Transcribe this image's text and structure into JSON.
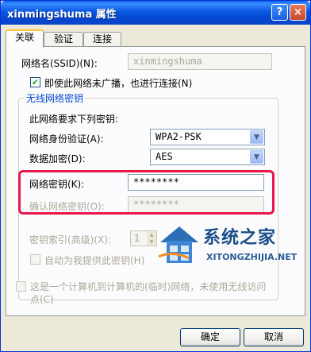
{
  "window": {
    "title": "xinmingshuma 属性",
    "help_button": "?",
    "close_button": "×"
  },
  "tabs": [
    {
      "label": "关联"
    },
    {
      "label": "验证"
    },
    {
      "label": "连接"
    }
  ],
  "form": {
    "ssid_label": "网络名(SSID)(N):",
    "ssid_value": "xinmingshuma",
    "broadcast_label": "即使此网络未广播，也进行连接(N)",
    "group_title": "无线网络密钥",
    "requires_key_label": "此网络要求下列密钥:",
    "auth_label": "网络身份验证(A):",
    "auth_value": "WPA2-PSK",
    "encryption_label": "数据加密(D):",
    "encryption_value": "AES",
    "key_label": "网络密钥(K):",
    "key_value": "********",
    "confirm_key_label": "确认网络密钥(O):",
    "confirm_key_value": "********",
    "key_index_label": "密钥索引(高级)(X):",
    "key_index_value": "1",
    "auto_key_label": "自动为我提供此密钥(H)",
    "adhoc_label": "这是一个计算机到计算机的(临时)网络，未使用无线访问点(C)"
  },
  "buttons": {
    "ok": "确定",
    "cancel": "取消"
  },
  "watermark": {
    "title": "系统之家",
    "url": "XITONGZHIJIA.NET"
  },
  "colors": {
    "titlebar": "#0A58E0",
    "dialog_bg": "#ECE9D8",
    "highlight_border": "#E8174A",
    "group_title": "#0046D5"
  }
}
